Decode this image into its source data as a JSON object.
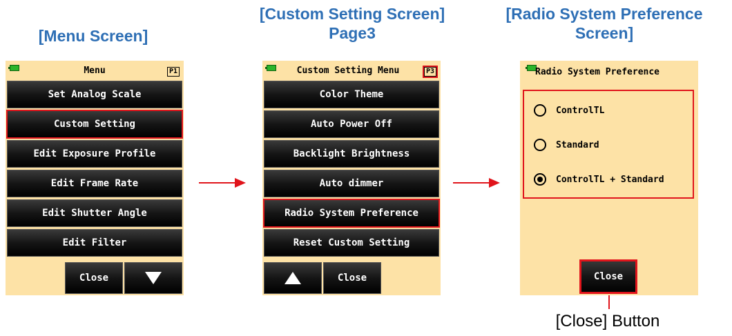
{
  "headings": {
    "menu": "[Menu Screen]",
    "custom_line1": "[Custom Setting Screen]",
    "custom_line2": "Page3",
    "radio_line1": "[Radio System Preference",
    "radio_line2": "Screen]"
  },
  "menu_screen": {
    "title": "Menu",
    "page": "P1",
    "items": [
      "Set Analog Scale",
      "Custom Setting",
      "Edit Exposure Profile",
      "Edit Frame Rate",
      "Edit Shutter Angle",
      "Edit Filter"
    ],
    "selected": "Custom Setting",
    "close_label": "Close",
    "down_icon": "triangle-down-icon"
  },
  "custom_screen": {
    "title": "Custom Setting Menu",
    "page": "P3",
    "items": [
      "Color Theme",
      "Auto Power Off",
      "Backlight Brightness",
      "Auto dimmer",
      "Radio System Preference",
      "Reset Custom Setting"
    ],
    "selected": "Radio System Preference",
    "close_label": "Close",
    "up_icon": "triangle-up-icon"
  },
  "radio_screen": {
    "title": "Radio System Preference",
    "options": [
      "ControlTL",
      "Standard",
      "ControlTL + Standard"
    ],
    "selected": "ControlTL + Standard",
    "close_label": "Close"
  },
  "callout": {
    "label": "[Close] Button"
  },
  "colors": {
    "heading": "#2e6fb5",
    "screen_bg": "#fde2a6",
    "highlight": "#e0141b",
    "arrow": "#e0141b"
  }
}
